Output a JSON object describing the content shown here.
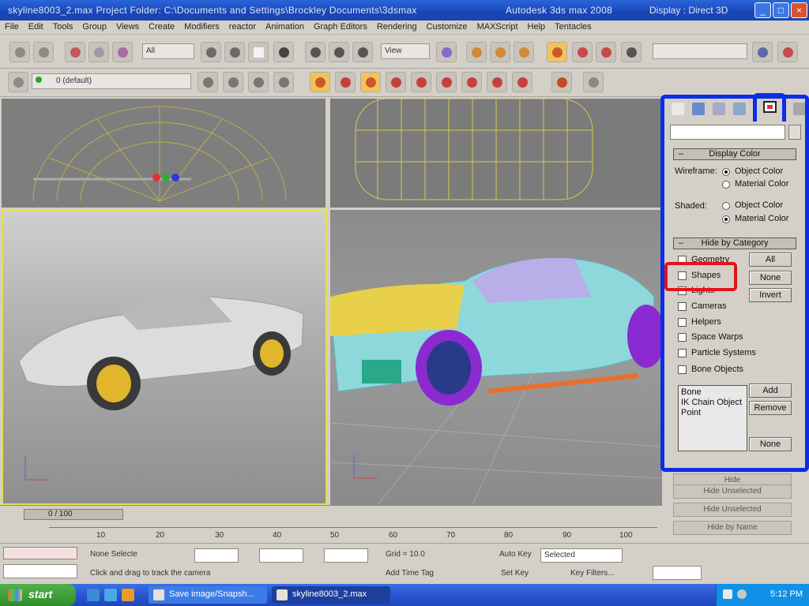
{
  "window": {
    "title": "skyline8003_2.max      Project Folder: C:\\Documents and Settings\\Brockley Documents\\3dsmax",
    "app_name": "Autodesk 3ds max 2008",
    "right_text": "Display : Direct 3D"
  },
  "menu": [
    "File",
    "Edit",
    "Tools",
    "Group",
    "Views",
    "Create",
    "Modifiers",
    "reactor",
    "Animation",
    "Graph Editors",
    "Rendering",
    "Customize",
    "MAXScript",
    "Help",
    "Tentacles"
  ],
  "toolbar": {
    "selection_filter": "All",
    "ref_coord": "View",
    "layer": "0 (default)"
  },
  "command_panel": {
    "display_color": {
      "header": "Display Color",
      "collapse": "–",
      "wireframe_label": "Wireframe:",
      "shaded_label": "Shaded:",
      "object_color": "Object Color",
      "material_color": "Material Color"
    },
    "hide_by_category": {
      "header": "Hide by Category",
      "collapse": "–",
      "items": [
        "Geometry",
        "Shapes",
        "Lights",
        "Cameras",
        "Helpers",
        "Space Warps",
        "Particle Systems",
        "Bone Objects"
      ],
      "all_button": "All",
      "none_button": "None",
      "invert_button": "Invert",
      "list_items": [
        "Bone",
        "IK Chain Object",
        "Point"
      ],
      "add_button": "Add",
      "remove_button": "Remove",
      "list_none_button": "None"
    },
    "lower_buttons": [
      "Hide",
      "Hide Unselected",
      "Hide Unselected",
      "Hide by Name"
    ]
  },
  "timeline": {
    "slider": "0 / 100",
    "ticks": [
      "10",
      "20",
      "30",
      "40",
      "50",
      "60",
      "70",
      "80",
      "90",
      "100"
    ]
  },
  "status": {
    "selection": "None Selecte",
    "prompt": "Click and drag to track the camera",
    "grid": "Grid = 10.0",
    "add_time_tag": "Add Time Tag",
    "auto_key": "Auto Key",
    "set_key": "Set Key",
    "selected": "Selected",
    "key_filters": "Key Filters..."
  },
  "taskbar": {
    "start": "start",
    "tasks": [
      "Save image/Snapsh...",
      "skyline8003_2.max"
    ],
    "clock": "5:12 PM"
  },
  "colors": {
    "highlight_blue": "#0a2de8",
    "highlight_red": "#e3121b",
    "active_viewport": "#e4dd57"
  }
}
